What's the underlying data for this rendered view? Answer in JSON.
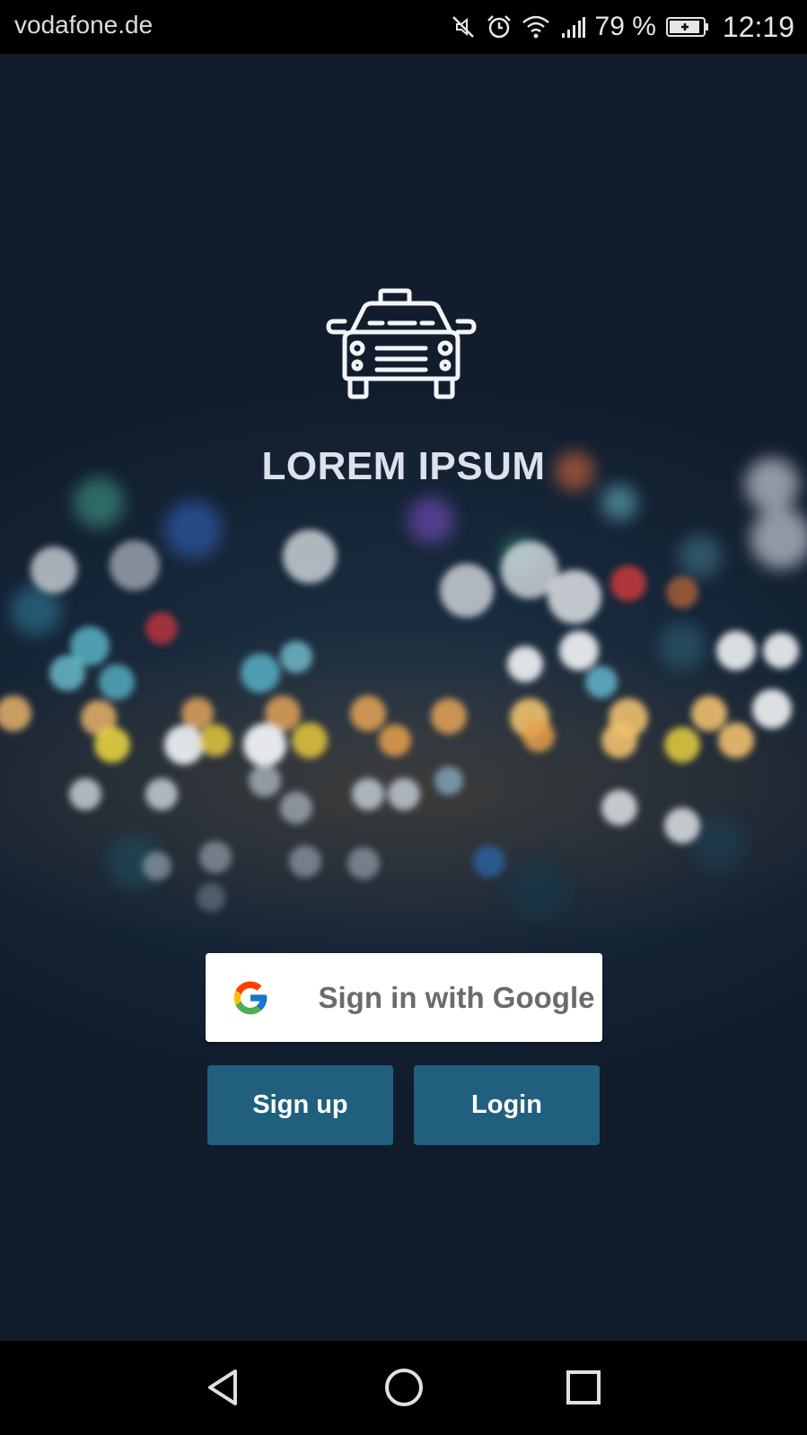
{
  "status_bar": {
    "carrier": "vodafone.de",
    "battery_percent": "79 %",
    "time": "12:19",
    "icons": [
      "mute-icon",
      "alarm-icon",
      "wifi-icon",
      "signal-icon",
      "battery-charging-icon"
    ]
  },
  "app": {
    "logo_icon": "taxi-icon",
    "title": "LOREM IPSUM"
  },
  "auth": {
    "google_label": "Sign in with Google",
    "google_icon": "google-icon",
    "signup_label": "Sign up",
    "login_label": "Login"
  },
  "nav_bar": {
    "icons": [
      "back-icon",
      "home-icon",
      "recent-apps-icon"
    ]
  },
  "colors": {
    "background": "#111d2d",
    "button_primary": "#215f7e",
    "google_button": "#ffffff",
    "title_text": "#dde2ea"
  }
}
